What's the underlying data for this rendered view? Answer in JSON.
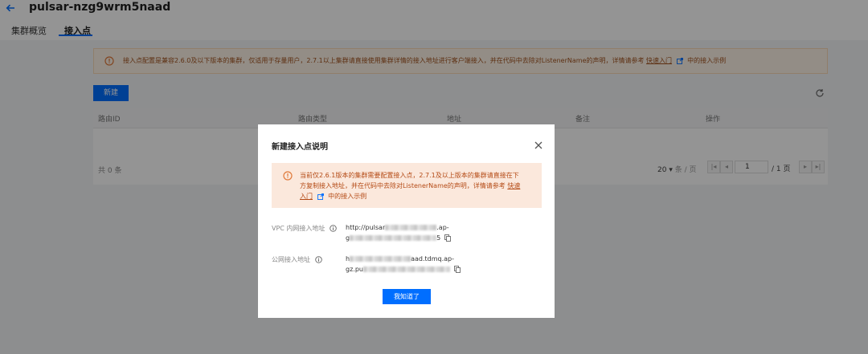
{
  "header": {
    "title": "pulsar-nzg9wrm5naad",
    "tabs": [
      {
        "label": "集群概览",
        "active": false
      },
      {
        "label": "接入点",
        "active": true
      }
    ]
  },
  "banner": {
    "text": "接入点配置是兼容2.6.0及以下版本的集群，仅适用于存量用户，2.7.1以上集群请直接使用集群详情的接入地址进行客户端接入，并在代码中去除对ListenerName的声明，详情请参考",
    "link": "快速入门",
    "suffix": "中的接入示例"
  },
  "toolbar": {
    "new_label": "新建"
  },
  "table": {
    "columns": [
      "路由ID",
      "路由类型",
      "地址",
      "备注",
      "操作"
    ],
    "total": "共 0 条",
    "page_size": "20",
    "page_size_unit": "条 / 页",
    "page": "1",
    "page_total": "/ 1 页"
  },
  "modal": {
    "title": "新建接入点说明",
    "notice": {
      "line1": "当前仅2.6.1版本的集群需要配置接入点，2.7.1及以上版本的集群请直接在下",
      "line2a": "方复制接入地址，并在代码中去除对ListenerName的声明，详情请参考",
      "line2_link": "快速",
      "line3_link": "入门",
      "line3_suffix": "中的接入示例"
    },
    "fields": [
      {
        "label": "VPC 内网接入地址",
        "value_line1_prefix": "http://pulsar",
        "value_line1_suffix": ".ap-",
        "value_line2_prefix": "g",
        "value_line2_suffix": "5"
      },
      {
        "label": "公网接入地址",
        "value_line1_prefix": "h",
        "value_line1_suffix": "aad.tdmq.ap-",
        "value_line2_prefix": "gz.pu",
        "value_line2_suffix": ""
      }
    ],
    "confirm_label": "我知道了"
  },
  "colors": {
    "accent": "#006eff",
    "warning": "#e07a3b",
    "overlay": "rgba(0,0,0,0.42)"
  },
  "icons": [
    "back-arrow-icon",
    "warning-icon",
    "external-link-icon",
    "refresh-icon",
    "close-icon",
    "info-icon",
    "copy-icon"
  ]
}
